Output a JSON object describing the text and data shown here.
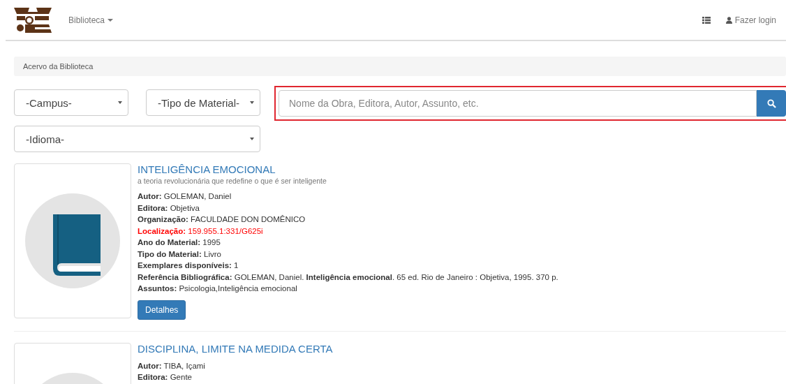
{
  "navbar": {
    "menu": "Biblioteca",
    "login": "Fazer login"
  },
  "breadcrumb": "Acervo da Biblioteca",
  "filters": [
    {
      "label": "-Campus-"
    },
    {
      "label": "-Tipo de Material-"
    }
  ],
  "search": {
    "placeholder": "Nome da Obra, Editora, Autor, Assunto, etc.",
    "highlighted": true
  },
  "language_filter": {
    "label": "-Idioma-"
  },
  "results": [
    {
      "title": "INTELIGÊNCIA EMOCIONAL",
      "subtitle": "a teoria revolucionária que redefine o que é ser inteligente",
      "fields": [
        {
          "label": "Autor:",
          "value": "GOLEMAN, Daniel",
          "kind": "normal"
        },
        {
          "label": "Editora:",
          "value": "Objetiva",
          "kind": "normal"
        },
        {
          "label": "Organização:",
          "value": "FACULDADE DON DOMÊNICO",
          "kind": "normal"
        },
        {
          "label": "Localização:",
          "value": "159.955.1:331/G625i",
          "kind": "alert"
        },
        {
          "label": "Ano do Material:",
          "value": "1995",
          "kind": "normal"
        },
        {
          "label": "Tipo do Material:",
          "value": "Livro",
          "kind": "normal"
        },
        {
          "label": "Exemplares disponíveis:",
          "value": "1",
          "kind": "normal"
        },
        {
          "label": "Referência Bibliográfica:",
          "value": "GOLEMAN, Daniel. **Inteligência emocional**. 65 ed. Rio de Janeiro : Objetiva, 1995. 370 p.",
          "kind": "normal"
        },
        {
          "label": "Assuntos:",
          "value": "Psicologia,Inteligência emocional",
          "kind": "normal"
        }
      ],
      "button": "Detalhes"
    },
    {
      "title": "DISCIPLINA, LIMITE NA MEDIDA CERTA",
      "fields": [
        {
          "label": "Autor:",
          "value": "TIBA, Içami",
          "kind": "normal"
        },
        {
          "label": "Editora:",
          "value": "Gente",
          "kind": "normal"
        }
      ]
    }
  ]
}
